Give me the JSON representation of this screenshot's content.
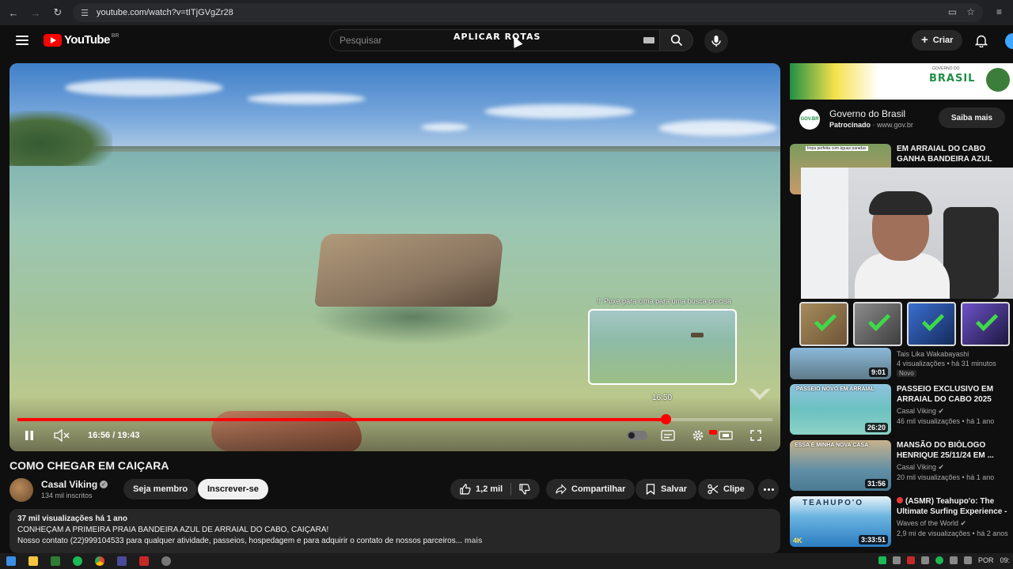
{
  "browser": {
    "url": "youtube.com/watch?v=tITjGVgZr28"
  },
  "header": {
    "logo_text": "YouTube",
    "country_code": "BR",
    "search_placeholder": "Pesquisar",
    "overlay_title": "APLICAR ROTAS",
    "create_label": "Criar"
  },
  "player": {
    "time_display": "16:56 / 19:43",
    "progress_fraction": 0.858,
    "preview_hint": "Puxe para cima para uma busca precisa",
    "preview_time": "16:50"
  },
  "video": {
    "title": "COMO CHEGAR EM CAIÇARA",
    "channel_name": "Casal Viking",
    "subscribers": "134 mil inscritos",
    "member_label": "Seja membro",
    "subscribe_label": "Inscrever-se",
    "likes": "1,2 mil",
    "share_label": "Compartilhar",
    "save_label": "Salvar",
    "clip_label": "Clipe"
  },
  "description": {
    "meta": "37 mil visualizações  há 1 ano",
    "line1": "CONHEÇAM A PRIMEIRA PRAIA BANDEIRA AZUL DE ARRAIAL DO CABO, CAIÇARA!",
    "line2": "Nosso contato (22)999104533 para qualquer atividade, passeios, hospedagem e para adquirir o contato de nossos parceiros...",
    "more": "mais"
  },
  "ad": {
    "banner_text": "BRASIL",
    "banner_small": "GOVERNO DO",
    "name": "Governo do Brasil",
    "sponsored": "Patrocinado",
    "domain": "www.gov.br",
    "cta": "Saiba mais",
    "logo_text": "GOV.BR"
  },
  "sidebar": {
    "items": [
      {
        "title": "EM ARRAIAL DO CABO GANHA BANDEIRA AZUL",
        "channel": "",
        "meta": "",
        "duration": ""
      },
      {
        "title": "",
        "channel": "Tais Lika Wakabayashi",
        "meta": "4 visualizações • há 31 minutos",
        "duration": "9:01",
        "badge": "Novo"
      },
      {
        "title": "PASSEIO EXCLUSIVO EM ARRAIAL DO CABO 2025",
        "channel": "Casal Viking",
        "meta": "46 mil visualizações • há 1 ano",
        "duration": "26:20"
      },
      {
        "title": "MANSÃO DO BIÓLOGO HENRIQUE 25/11/24 EM ...",
        "channel": "Casal Viking",
        "meta": "20 mil visualizações • há 1 ano",
        "duration": "31:56"
      },
      {
        "title": "(ASMR) Teahupo'o: The Ultimate Surfing Experience - ...",
        "channel": "Waves of the World",
        "meta": "2,9 mi de visualizações • há 2 anos",
        "duration": "3:33:51"
      }
    ],
    "thumb_texts": [
      "Impa perfeita com águas paradas",
      "PASSEIO NOVO EM ARRAIAL",
      "ESSA É MINHA NOVA CASA",
      "TEAHUPO'O",
      "4K"
    ]
  },
  "taskbar": {
    "lang": "POR",
    "clock": "09:"
  },
  "colors": {
    "accent_red": "#ff0000",
    "background": "#0f0f0f",
    "check_green": "#3fd84a"
  }
}
